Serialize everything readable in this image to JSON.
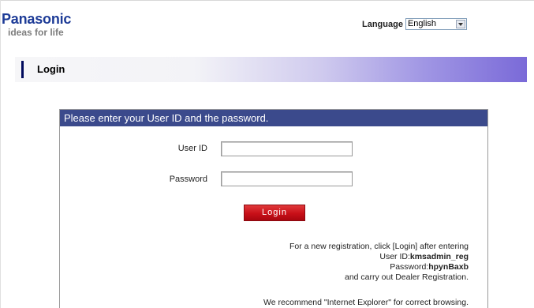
{
  "header": {
    "brand": "Panasonic",
    "tagline": "ideas for life",
    "language_label": "Language",
    "language_value": "English"
  },
  "section": {
    "title": "Login"
  },
  "form": {
    "instruction": "Please enter your User ID and the password.",
    "user_id_label": "User ID",
    "password_label": "Password",
    "user_id_value": "",
    "password_value": "",
    "login_button": "Login"
  },
  "notes": {
    "line1": "For a new registration, click [Login] after entering",
    "user_id_prefix": "User ID:",
    "user_id_value": "kmsadmin_reg",
    "password_prefix": "Password:",
    "password_value": "hpynBaxb",
    "line4": "and carry out Dealer Registration.",
    "recommend": "We recommend \"Internet Explorer\" for correct browsing."
  },
  "colors": {
    "brand_blue": "#1d3b97",
    "panel_header": "#3b4a8c",
    "button_red": "#c80f18",
    "bar_gradient_end": "#7a6ad8"
  }
}
